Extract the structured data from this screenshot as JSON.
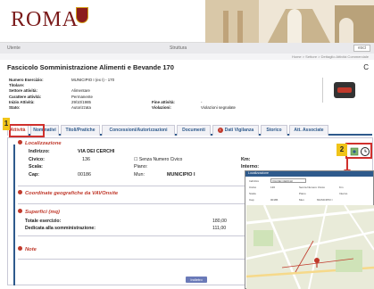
{
  "header": {
    "logo": "ROMA",
    "topbar_left": "Utente",
    "topbar_mid": "Struttura",
    "topbar_btn": "esci",
    "breadcrumb": "Home > Settore > Dettaglio Attività Commerciale"
  },
  "page": {
    "title": "Fascicolo Somministrazione Alimenti e Bevande 170",
    "close": "C"
  },
  "info": {
    "rows": [
      {
        "k": "Numero Esercizio:",
        "v": "MUNICIPIO I (ex I) - 170",
        "k2": "",
        "v2": ""
      },
      {
        "k": "Titolare:",
        "v": "",
        "k2": "",
        "v2": ""
      },
      {
        "k": "Settore attività:",
        "v": "Alimentare",
        "k2": "",
        "v2": ""
      },
      {
        "k": "Carattere attività:",
        "v": "Permanente",
        "k2": "",
        "v2": ""
      },
      {
        "k": "Inizio Attività:",
        "v": "29/10/1985",
        "k2": "Fine attività:",
        "v2": "-"
      },
      {
        "k": "Stato:",
        "v": "Autorizzata",
        "k2": "Violazioni:",
        "v2": "Violazioni segnalate"
      }
    ]
  },
  "tabs": [
    {
      "label": "Attività",
      "active": true
    },
    {
      "label": "Nominativi",
      "active": false
    },
    {
      "label": "Titoli/Pratiche",
      "active": false
    },
    {
      "label": "Concessioni/Autorizzazioni",
      "active": false
    },
    {
      "label": "Documenti",
      "active": false
    },
    {
      "label": "Dati Vigilanza",
      "active": false,
      "warn": true
    },
    {
      "label": "Storico",
      "active": false
    },
    {
      "label": "Att. Associate",
      "active": false
    }
  ],
  "markers": {
    "one": "1",
    "two": "2"
  },
  "localizzazione": {
    "heading": "Localizzazione",
    "indirizzo_label": "Indirizzo:",
    "indirizzo_value": "VIA DEI CERCHI",
    "civico_label": "Civico:",
    "civico_value": "136",
    "senza_civico_label": "Senza Numero Civico",
    "km_label": "Km:",
    "scala_label": "Scala:",
    "piano_label": "Piano:",
    "interno_label": "Interno:",
    "cap_label": "Cap:",
    "cap_value": "00186",
    "mun_label": "Mun:",
    "mun_value": "MUNICIPIO I"
  },
  "coordinate": {
    "heading": "Coordinate geografiche da VAVOnsite"
  },
  "superfici": {
    "heading": "Superfici (mq)",
    "totale_label": "Totale esercizio:",
    "totale_value": "180,00",
    "dedicata_label": "Dedicata alla somministrazione:",
    "dedicata_value": "111,00"
  },
  "note": {
    "heading": "Note"
  },
  "bottom_button": "Indietro",
  "map_popup": {
    "title": "Localizzazione",
    "fields": [
      "Indirizzo",
      "VIA DEI CERCHI",
      "Civico",
      "136",
      "Senza Numero Civico",
      "Km",
      "Scala",
      "Piano",
      "Interno",
      "Cap",
      "00186",
      "Mun",
      "MUNICIPIO I"
    ]
  },
  "colors": {
    "accent": "#2e5a8c",
    "alert": "#c0392b",
    "marker": "#f0c419"
  }
}
